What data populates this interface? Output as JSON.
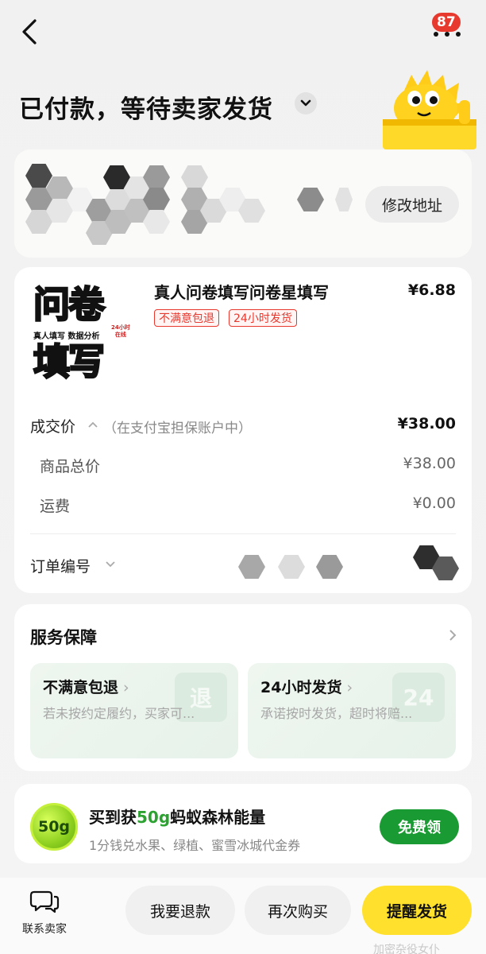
{
  "header": {
    "badge_count": "87",
    "status_title": "已付款，等待卖家发货"
  },
  "address": {
    "edit_label": "修改地址"
  },
  "product": {
    "image_big_top": "问卷",
    "image_big_bottom": "填写",
    "image_small": "真人填写 数据分析",
    "image_tag": "24小时\n在线",
    "title": "真人问卷填写问卷星填写",
    "price": "¥6.88",
    "tags": [
      "不满意包退",
      "24小时发货"
    ]
  },
  "pricing": {
    "deal_label": "成交价",
    "deal_note": "（在支付宝担保账户中）",
    "deal_value": "¥38.00",
    "goods_label": "商品总价",
    "goods_value": "¥38.00",
    "shipping_label": "运费",
    "shipping_value": "¥0.00",
    "order_no_label": "订单编号"
  },
  "service": {
    "title": "服务保障",
    "items": [
      {
        "title": "不满意包退",
        "desc": "若未按约定履约，买家可...",
        "mark": "退"
      },
      {
        "title": "24小时发货",
        "desc": "承诺按时发货，超时将赔...",
        "mark": "24"
      }
    ]
  },
  "promo": {
    "ball_label": "50g",
    "title_prefix": "买到获",
    "title_highlight": "50g",
    "title_suffix": "蚂蚁森林能量",
    "desc": "1分钱兑水果、绿植、蜜雪冰城代金券",
    "claim_label": "免费领"
  },
  "bottom": {
    "contact_label": "联系卖家",
    "refund_label": "我要退款",
    "rebuy_label": "再次购买",
    "remind_label": "提醒发货",
    "watermark": "加密杂役女仆"
  },
  "colors": {
    "accent_yellow": "#ffe02d",
    "badge_red": "#e8392f",
    "claim_green": "#1a9a32"
  }
}
